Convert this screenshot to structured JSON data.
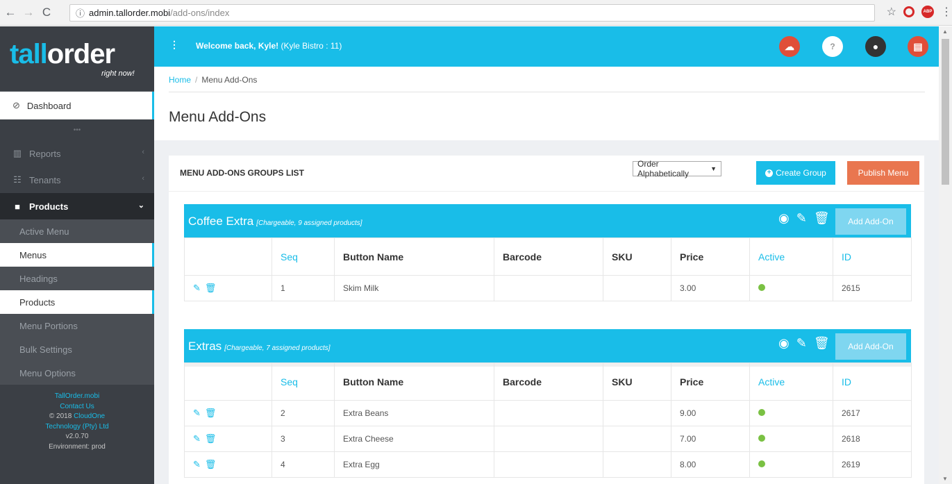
{
  "browser": {
    "url_host": "admin.tallorder.mobi",
    "url_path": "/add-ons/index"
  },
  "sidebar": {
    "logo_tall": "tall",
    "logo_order": "order",
    "logo_tagline": "right now!",
    "dashboard_label": "Dashboard",
    "dots": "•••",
    "groups": [
      {
        "label": "Reports"
      },
      {
        "label": "Tenants"
      },
      {
        "label": "Products"
      }
    ],
    "sub_items": [
      {
        "label": "Active Menu"
      },
      {
        "label": "Menus"
      },
      {
        "label": "Headings"
      },
      {
        "label": "Products"
      },
      {
        "label": "Menu Portions"
      },
      {
        "label": "Bulk Settings"
      },
      {
        "label": "Menu Options"
      }
    ],
    "footer": {
      "site": "TallOrder.mobi",
      "contact": "Contact Us",
      "copyright": "© 2018",
      "company_a": "CloudOne",
      "company_b": "Technology (Pty) Ltd",
      "version": "v2.0.70",
      "environment": "Environment: prod"
    }
  },
  "topbar": {
    "welcome_bold": "Welcome back, Kyle!",
    "welcome_rest": " (Kyle Bistro : 11)",
    "help_label": "?",
    "colors": {
      "bar": "#19bde8",
      "cloud": "#e04e39",
      "user": "#333333",
      "store": "#e04e39"
    }
  },
  "content": {
    "breadcrumb_home": "Home",
    "breadcrumb_sep": "/",
    "breadcrumb_current": "Menu Add-Ons",
    "page_title": "Menu Add-Ons",
    "panel_title": "MENU ADD-ONS GROUPS LIST",
    "order_select": "Order Alphabetically",
    "create_group": "Create Group",
    "publish_menu": "Publish Menu",
    "columns": [
      "",
      "Seq",
      "Button Name",
      "Barcode",
      "SKU",
      "Price",
      "Active",
      "ID"
    ],
    "add_addon": "Add Add-On",
    "groups": [
      {
        "name": "Coffee Extra",
        "meta": "[Chargeable, 9 assigned products]",
        "rows": [
          {
            "seq": "1",
            "name": "Skim Milk",
            "barcode": "",
            "sku": "",
            "price": "3.00",
            "id": "2615"
          }
        ]
      },
      {
        "name": "Extras",
        "meta": "[Chargeable, 7 assigned products]",
        "rows": [
          {
            "seq": "2",
            "name": "Extra Beans",
            "barcode": "",
            "sku": "",
            "price": "9.00",
            "id": "2617"
          },
          {
            "seq": "3",
            "name": "Extra Cheese",
            "barcode": "",
            "sku": "",
            "price": "7.00",
            "id": "2618"
          },
          {
            "seq": "4",
            "name": "Extra Egg",
            "barcode": "",
            "sku": "",
            "price": "8.00",
            "id": "2619"
          }
        ]
      }
    ]
  }
}
